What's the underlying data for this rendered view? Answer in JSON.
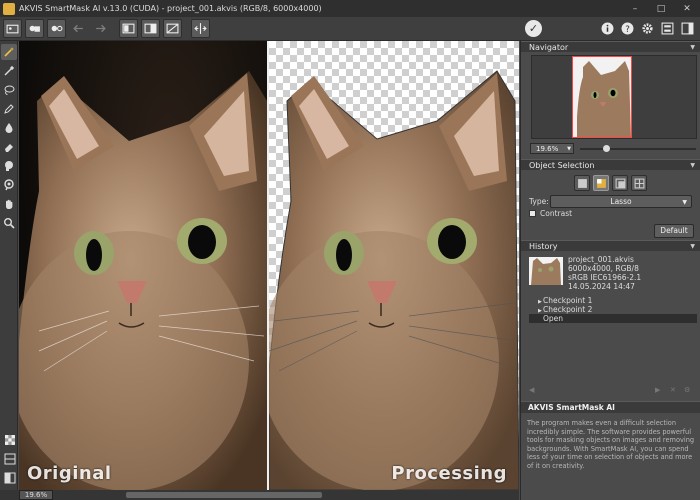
{
  "window": {
    "title": "AKVIS SmartMask AI v.13.0 (CUDA) - project_001.akvis (RGB/8, 6000x4000)",
    "minimize": "–",
    "maximize": "□",
    "close": "✕"
  },
  "toolbar": {
    "left_icons": [
      "open-file-icon",
      "save-icon",
      "open-image-icon",
      "undo-icon",
      "redo-icon",
      "home-icon",
      "before-after-icon",
      "compare-icon",
      "fit-icon",
      "split-view-icon"
    ],
    "right_icons": [
      "run-check-icon",
      "info-icon",
      "help-icon",
      "settings-icon",
      "preferences-icon",
      "dock-icon"
    ]
  },
  "left_tools": [
    "magic-brush-icon",
    "brush-icon",
    "lasso-icon",
    "pen-icon",
    "drop-icon",
    "eraser-icon",
    "paint-bucket-icon",
    "color-picker-icon",
    "hand-icon",
    "zoom-icon"
  ],
  "canvas": {
    "left_label": "Original",
    "right_label": "Processing"
  },
  "status": {
    "zoom": "19.6%"
  },
  "navigator": {
    "header": "Navigator",
    "zoom": "19.6%",
    "zoom_slider_percent": 20
  },
  "object_selection": {
    "header": "Object Selection",
    "type_label": "Type:",
    "type_value": "Lasso",
    "contrast_label": "Contrast",
    "default_button": "Default"
  },
  "history": {
    "header": "History",
    "item": {
      "name": "project_001.akvis",
      "size": "6000x4000, RGB/8",
      "profile": "sRGB IEC61966-2.1",
      "date": "14.05.2024 14:47"
    },
    "checkpoints": [
      {
        "label": "Checkpoint 1"
      },
      {
        "label": "Checkpoint 2"
      }
    ],
    "open_label": "Open"
  },
  "info": {
    "header": "AKVIS SmartMask AI",
    "text": "The program makes even a difficult selection incredibly simple. The software provides powerful tools for masking objects on images and removing backgrounds. With SmartMask AI, you can spend less of your time on selection of objects and more of it on creativity."
  },
  "colors": {
    "accent": "#e0b040",
    "panel_bg": "#4b4b4b",
    "header_bg": "#3a3a3a"
  }
}
